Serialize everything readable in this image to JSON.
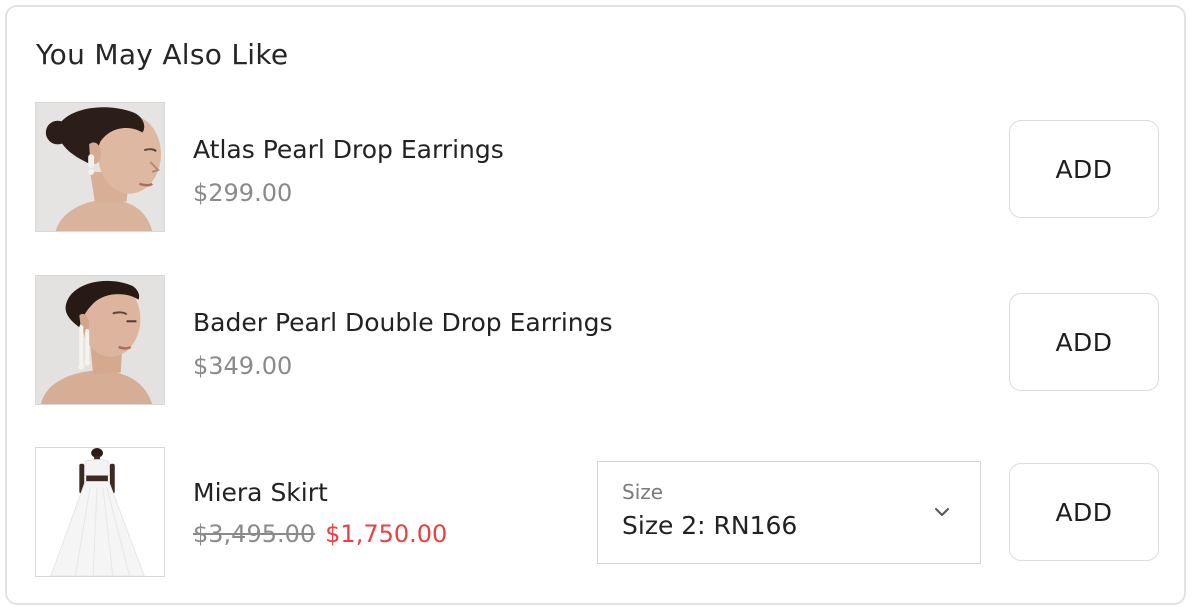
{
  "section": {
    "title": "You May Also Like"
  },
  "products": [
    {
      "name": "Atlas Pearl Drop Earrings",
      "price": "$299.00",
      "add_label": "ADD"
    },
    {
      "name": "Bader Pearl Double Drop Earrings",
      "price": "$349.00",
      "add_label": "ADD"
    },
    {
      "name": "Miera Skirt",
      "original_price": "$3,495.00",
      "sale_price": "$1,750.00",
      "add_label": "ADD",
      "size_select": {
        "caption": "Size",
        "value": "Size 2: RN166"
      }
    }
  ],
  "colors": {
    "sale_price": "#e8413f",
    "muted_price": "#8a8a8a",
    "border": "#dcdcdc"
  },
  "icons": {
    "dropdown": "chevron-down-icon"
  }
}
